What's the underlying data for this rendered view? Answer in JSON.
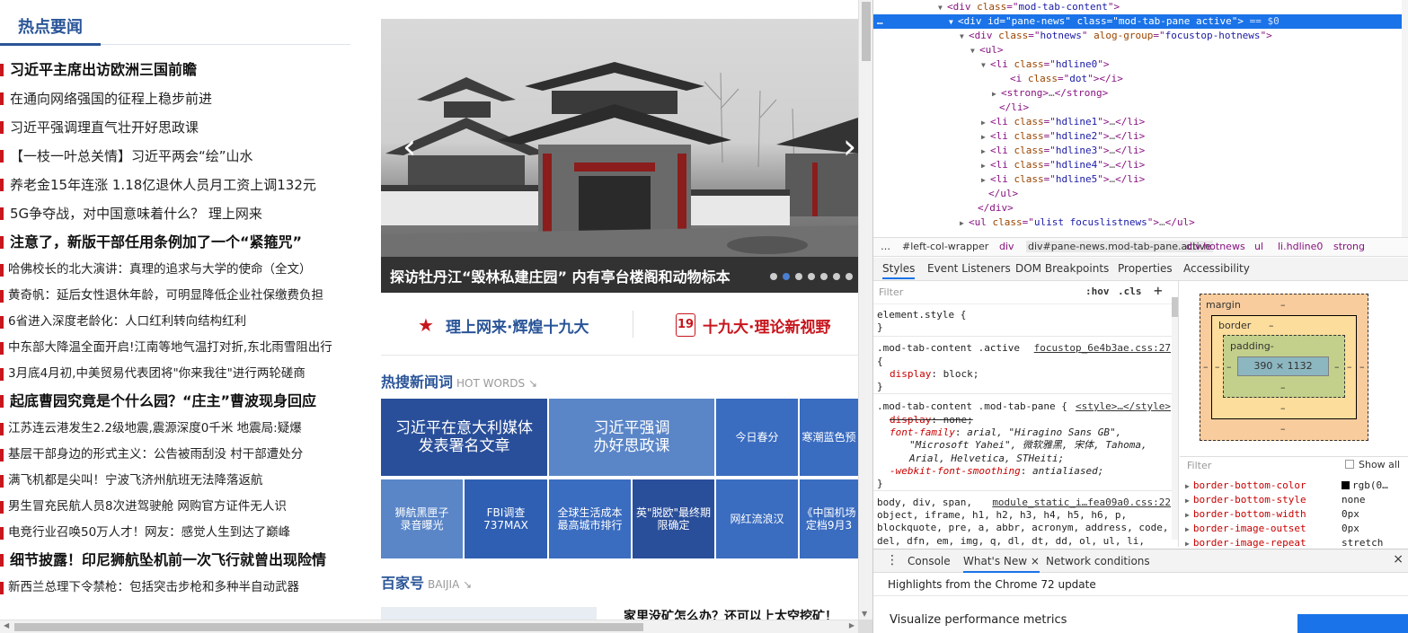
{
  "web": {
    "hot_tab_label": "热点要闻",
    "news": [
      {
        "t": "习近平主席出访欧洲三国前瞻",
        "s": "big"
      },
      {
        "t": "在通向网络强国的征程上稳步前进",
        "s": "mid"
      },
      {
        "t": "习近平强调理直气壮开好思政课",
        "s": "mid"
      },
      {
        "t": "【一枝一叶总关情】习近平两会“绘”山水",
        "s": "mid"
      },
      {
        "t": "养老金15年连涨 1.18亿退休人员月工资上调132元",
        "s": "mid"
      },
      {
        "t": "5G争夺战，对中国意味着什么？   理上网来",
        "s": "mid"
      },
      {
        "t": "注意了，新版干部任用条例加了一个“紧箍咒”",
        "s": "big"
      },
      {
        "t": "哈佛校长的北大演讲：真理的追求与大学的使命（全文）",
        "s": "small"
      },
      {
        "t": "黄奇帆：延后女性退休年龄，可明显降低企业社保缴费负担",
        "s": "small"
      },
      {
        "t": "6省进入深度老龄化：人口红利转向结构红利",
        "s": "small"
      },
      {
        "t": "中东部大降温全面开启!江南等地气温打对折,东北雨雪阻出行",
        "s": "small"
      },
      {
        "t": "3月底4月初,中美贸易代表团将\"你来我往\"进行两轮磋商",
        "s": "small"
      },
      {
        "t": "起底曹园究竟是个什么园？“庄主”曹波现身回应",
        "s": "big"
      },
      {
        "t": "江苏连云港发生2.2级地震,震源深度0千米 地震局:疑爆",
        "s": "small"
      },
      {
        "t": "基层干部身边的形式主义：公告被雨刮没 村干部遭处分",
        "s": "small"
      },
      {
        "t": "满飞机都是尖叫！宁波飞济州航班无法降落返航",
        "s": "small"
      },
      {
        "t": "男生冒充民航人员8次进驾驶舱 网购官方证件无人识",
        "s": "small"
      },
      {
        "t": "电竞行业召唤50万人才！网友：感觉人生到达了巅峰",
        "s": "small"
      },
      {
        "t": "细节披露！印尼狮航坠机前一次飞行就曾出现险情",
        "s": "big"
      },
      {
        "t": "新西兰总理下令禁枪：包括突击步枪和多种半自动武器",
        "s": "small"
      }
    ],
    "carousel": {
      "caption": "探访牡丹江“毁林私建庄园” 内有亭台楼阁和动物标本",
      "prev_arrow": "‹",
      "next_arrow": "›",
      "dot_count": 7,
      "active_dot": 1
    },
    "banners": [
      {
        "icon": "★",
        "label": "理上网来·辉煌十九大",
        "color": "#2a5598",
        "icon_color": "#c8161d"
      },
      {
        "icon": "19",
        "label": "十九大·理论新视野",
        "color": "#c8161d",
        "icon_color": "#c8161d"
      }
    ],
    "hot_words": {
      "title": "热搜新闻词",
      "sub": "HOT WORDS ↘"
    },
    "tiles": [
      {
        "t": "习近平在意大利媒体\n发表署名文章",
        "c": "#2a4f9a"
      },
      {
        "t": "习近平强调\n办好思政课",
        "c": "#5a86c8"
      },
      {
        "t": "今日春分",
        "c": "#3a6cc0"
      },
      {
        "t": "寒潮蓝色预",
        "c": "#3a6cc0"
      },
      {
        "t": "狮航黑匣子\n录音曝光",
        "c": "#5a86c8"
      },
      {
        "t": "FBI调查737MAX",
        "c": "#2f5fb3"
      },
      {
        "t": "全球生活成本\n最高城市排行",
        "c": "#3a6cc0"
      },
      {
        "t": "英\"脱欧\"最终期\n限确定",
        "c": "#2a4f9a"
      },
      {
        "t": "网红流浪汉",
        "c": "#3a6cc0"
      },
      {
        "t": "《中国机场\n定档9月3",
        "c": "#3a6cc0"
      }
    ],
    "baijia": {
      "title": "百家号",
      "sub": "BAIJIA ↘",
      "headline": "家里没矿怎么办？还可以上太空挖矿！"
    }
  },
  "devtools": {
    "dom": [
      {
        "i": 76,
        "tri": "▼",
        "html": [
          [
            "t",
            "<div "
          ],
          [
            "a",
            "class"
          ],
          [
            "t",
            "=\""
          ],
          [
            "v",
            "mod-tab-content"
          ],
          [
            "t",
            "\">"
          ]
        ]
      },
      {
        "i": 88,
        "tri": "▼",
        "sel": true,
        "html": [
          [
            "t",
            "<div "
          ],
          [
            "a",
            "id"
          ],
          [
            "t",
            "=\""
          ],
          [
            "v",
            "pane-news"
          ],
          [
            "t",
            "\" "
          ],
          [
            "a",
            "class"
          ],
          [
            "t",
            "=\""
          ],
          [
            "v",
            "mod-tab-pane active"
          ],
          [
            "t",
            "\">"
          ],
          [
            "p",
            " == $0"
          ]
        ]
      },
      {
        "i": 100,
        "tri": "▼",
        "html": [
          [
            "t",
            "<div "
          ],
          [
            "a",
            "class"
          ],
          [
            "t",
            "=\""
          ],
          [
            "v",
            "hotnews"
          ],
          [
            "t",
            "\" "
          ],
          [
            "a",
            "alog-group"
          ],
          [
            "t",
            "=\""
          ],
          [
            "v",
            "focustop-hotnews"
          ],
          [
            "t",
            "\">"
          ]
        ]
      },
      {
        "i": 112,
        "tri": "▼",
        "html": [
          [
            "t",
            "<ul>"
          ]
        ]
      },
      {
        "i": 124,
        "tri": "▼",
        "html": [
          [
            "t",
            "<li "
          ],
          [
            "a",
            "class"
          ],
          [
            "t",
            "=\""
          ],
          [
            "v",
            "hdline0"
          ],
          [
            "t",
            "\">"
          ]
        ]
      },
      {
        "i": 146,
        "tri": "",
        "html": [
          [
            "t",
            "<i "
          ],
          [
            "a",
            "class"
          ],
          [
            "t",
            "=\""
          ],
          [
            "v",
            "dot"
          ],
          [
            "t",
            "\"></i>"
          ]
        ]
      },
      {
        "i": 136,
        "tri": "▶",
        "html": [
          [
            "t",
            "<strong>"
          ],
          [
            "p",
            "…"
          ],
          [
            "t",
            "</strong>"
          ]
        ]
      },
      {
        "i": 134,
        "tri": "",
        "html": [
          [
            "t",
            "</li>"
          ]
        ]
      },
      {
        "i": 124,
        "tri": "▶",
        "html": [
          [
            "t",
            "<li "
          ],
          [
            "a",
            "class"
          ],
          [
            "t",
            "=\""
          ],
          [
            "v",
            "hdline1"
          ],
          [
            "t",
            "\">"
          ],
          [
            "p",
            "…"
          ],
          [
            "t",
            "</li>"
          ]
        ]
      },
      {
        "i": 124,
        "tri": "▶",
        "html": [
          [
            "t",
            "<li "
          ],
          [
            "a",
            "class"
          ],
          [
            "t",
            "=\""
          ],
          [
            "v",
            "hdline2"
          ],
          [
            "t",
            "\">"
          ],
          [
            "p",
            "…"
          ],
          [
            "t",
            "</li>"
          ]
        ]
      },
      {
        "i": 124,
        "tri": "▶",
        "html": [
          [
            "t",
            "<li "
          ],
          [
            "a",
            "class"
          ],
          [
            "t",
            "=\""
          ],
          [
            "v",
            "hdline3"
          ],
          [
            "t",
            "\">"
          ],
          [
            "p",
            "…"
          ],
          [
            "t",
            "</li>"
          ]
        ]
      },
      {
        "i": 124,
        "tri": "▶",
        "html": [
          [
            "t",
            "<li "
          ],
          [
            "a",
            "class"
          ],
          [
            "t",
            "=\""
          ],
          [
            "v",
            "hdline4"
          ],
          [
            "t",
            "\">"
          ],
          [
            "p",
            "…"
          ],
          [
            "t",
            "</li>"
          ]
        ]
      },
      {
        "i": 124,
        "tri": "▶",
        "html": [
          [
            "t",
            "<li "
          ],
          [
            "a",
            "class"
          ],
          [
            "t",
            "=\""
          ],
          [
            "v",
            "hdline5"
          ],
          [
            "t",
            "\">"
          ],
          [
            "p",
            "…"
          ],
          [
            "t",
            "</li>"
          ]
        ]
      },
      {
        "i": 122,
        "tri": "",
        "html": [
          [
            "t",
            "</ul>"
          ]
        ]
      },
      {
        "i": 110,
        "tri": "",
        "html": [
          [
            "t",
            "</div>"
          ]
        ]
      },
      {
        "i": 100,
        "tri": "▶",
        "html": [
          [
            "t",
            "<ul "
          ],
          [
            "a",
            "class"
          ],
          [
            "t",
            "=\""
          ],
          [
            "v",
            "ulist focuslistnews"
          ],
          [
            "t",
            "\">"
          ],
          [
            "p",
            "…"
          ],
          [
            "t",
            "</ul>"
          ]
        ]
      }
    ],
    "ellipsis_marker": "…",
    "breadcrumb": [
      "…",
      "#left-col-wrapper",
      "div",
      "div#pane-news.mod-tab-pane.active",
      "div.hotnews",
      "ul",
      "li.hdline0",
      "strong"
    ],
    "subtabs": [
      "Styles",
      "Event Listeners",
      "DOM Breakpoints",
      "Properties",
      "Accessibility"
    ],
    "styles_filter": {
      "placeholder": "Filter",
      "hov": ":hov",
      "cls": ".cls",
      "plus": "+"
    },
    "styles": [
      {
        "k": "sel",
        "t": "element.style {"
      },
      {
        "k": "close",
        "t": "}"
      },
      {
        "k": "sel",
        "t": ".mod-tab-content .active",
        "src": "focustop_6e4b3ae.css:27"
      },
      {
        "k": "sel",
        "t": "{"
      },
      {
        "k": "prop",
        "p": "display",
        "v": "block;"
      },
      {
        "k": "close",
        "t": "}"
      },
      {
        "k": "sel",
        "t": ".mod-tab-content .mod-tab-pane {",
        "src": "<style>…</style>"
      },
      {
        "k": "strike",
        "p": "display",
        "v": "none;"
      },
      {
        "k": "propi",
        "p": "font-family",
        "v": "arial, \"Hiragino Sans GB\","
      },
      {
        "k": "cont",
        "v": "\"Microsoft Yahei\", 微软雅黑, 宋体, Tahoma,"
      },
      {
        "k": "cont",
        "v": "Arial, Helvetica, STHeiti;"
      },
      {
        "k": "propi",
        "p": "-webkit-font-smoothing",
        "v": "antialiased;"
      },
      {
        "k": "close",
        "t": "}"
      },
      {
        "k": "sel",
        "t": "body, div, span,",
        "src": "module_static_i…fea09a0.css:22"
      },
      {
        "k": "sel",
        "t": "object, iframe, h1, h2, h3, h4, h5, h6, p,"
      },
      {
        "k": "sel",
        "t": "blockquote, pre, a, abbr, acronym, address, code,"
      },
      {
        "k": "sel",
        "t": "del, dfn, em, img, q, dl, dt, dd, ol, ul, li,"
      }
    ],
    "box_model": {
      "margin": "margin",
      "border": "border",
      "padding": "padding-",
      "content": "390 × 1132",
      "dash": "–"
    },
    "computed": {
      "filter_placeholder": "Filter",
      "show_all": "Show all",
      "props": [
        {
          "n": "border-bottom-color",
          "v": "rgb(0…",
          "swatch": true
        },
        {
          "n": "border-bottom-style",
          "v": "none"
        },
        {
          "n": "border-bottom-width",
          "v": "0px"
        },
        {
          "n": "border-image-outset",
          "v": "0px"
        },
        {
          "n": "border-image-repeat",
          "v": "stretch"
        }
      ]
    },
    "drawer_tabs": [
      "Console",
      "What's New",
      "Network conditions"
    ],
    "drawer_menu": "⋮",
    "drawer_close_x": "×",
    "panel_close": "×",
    "highlights": "Highlights from the Chrome 72 update",
    "whatsnew_item": "Visualize performance metrics"
  }
}
